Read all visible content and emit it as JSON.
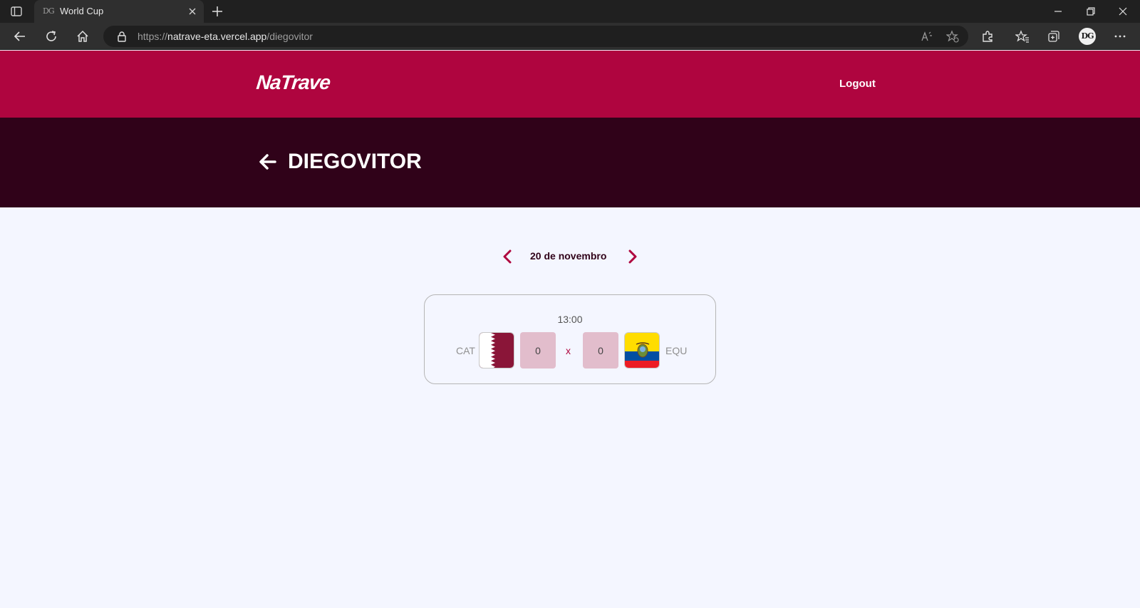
{
  "browser": {
    "tab_title": "World Cup",
    "tab_favicon_text": "DG",
    "url_prefix": "https://",
    "url_host": "natrave-eta.vercel.app",
    "url_path": "/diegovitor",
    "profile_initials": "DG"
  },
  "header": {
    "logo": "NaTrave",
    "logout_label": "Logout"
  },
  "user": {
    "username": "DIEGOVITOR"
  },
  "date_nav": {
    "current_date": "20 de novembro"
  },
  "game": {
    "time": "13:00",
    "home": {
      "code": "CAT",
      "score": "0",
      "flag": "qatar-flag"
    },
    "away": {
      "code": "EQU",
      "score": "0",
      "flag": "ecuador-flag"
    },
    "separator": "x"
  },
  "colors": {
    "brand": "#af053f",
    "dark": "#300219",
    "background": "#f4f6ff",
    "score_box": "#e2bdcc"
  }
}
